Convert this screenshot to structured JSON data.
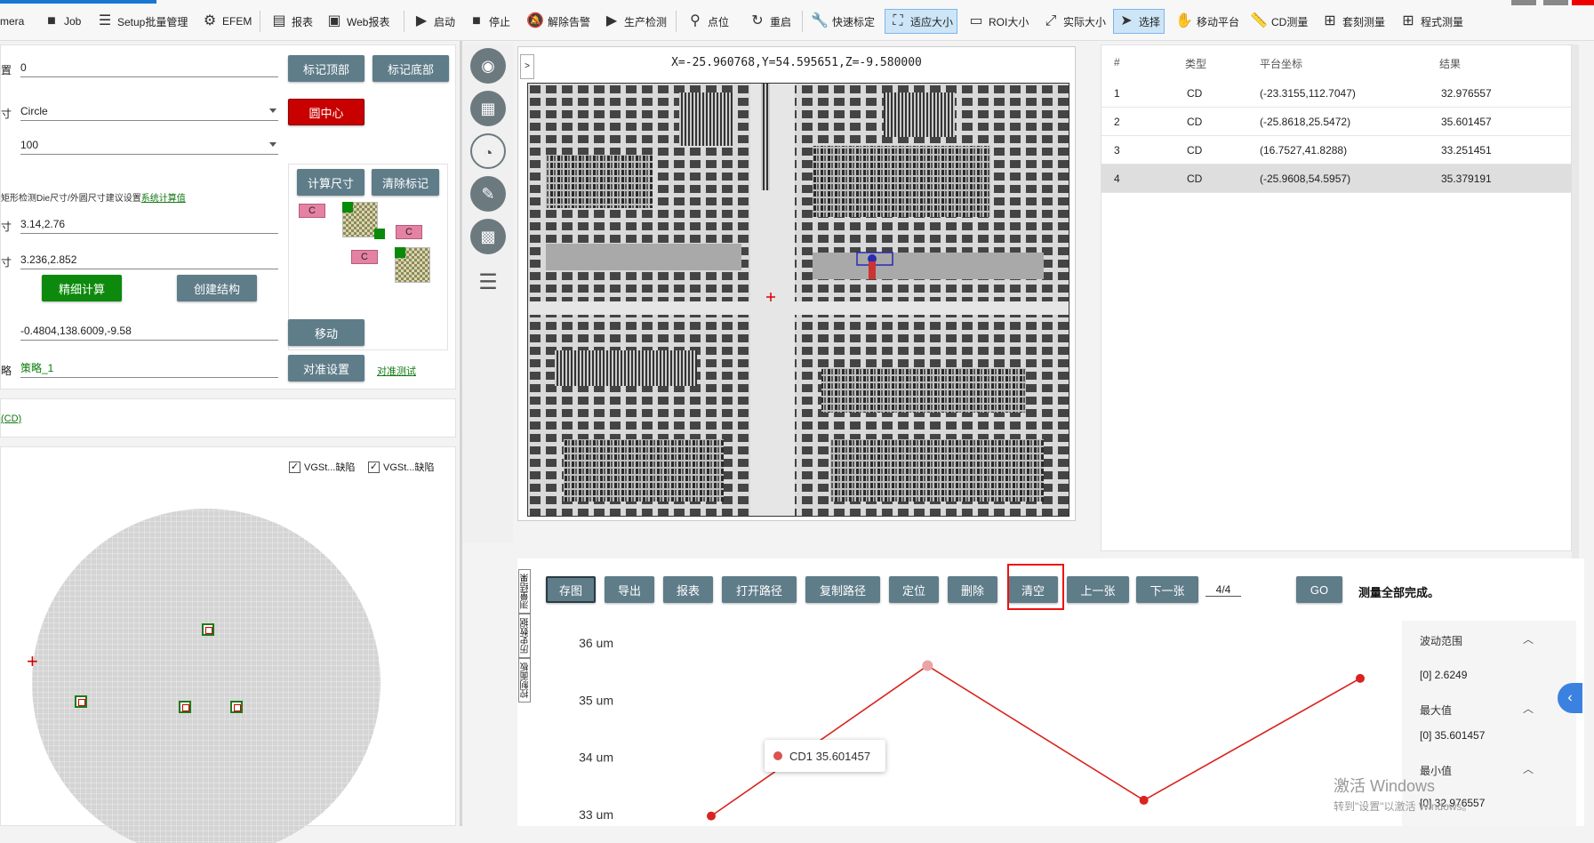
{
  "toolbar": {
    "items": [
      {
        "label": "mera",
        "icon": "camera-icon"
      },
      {
        "label": "Job",
        "icon": "briefcase-icon"
      },
      {
        "label": "Setup批量管理",
        "icon": "checklist-icon"
      },
      {
        "label": "EFEM",
        "icon": "robot-arm-icon"
      },
      {
        "label": "报表",
        "icon": "document-icon"
      },
      {
        "label": "Web报表",
        "icon": "monitor-icon"
      },
      {
        "label": "启动",
        "icon": "play-icon"
      },
      {
        "label": "停止",
        "icon": "stop-icon"
      },
      {
        "label": "解除告警",
        "icon": "bell-off-icon"
      },
      {
        "label": "生产检测",
        "icon": "play-icon"
      },
      {
        "label": "点位",
        "icon": "location-pin-icon"
      },
      {
        "label": "重启",
        "icon": "refresh-icon"
      },
      {
        "label": "快速标定",
        "icon": "wrench-icon"
      },
      {
        "label": "适应大小",
        "icon": "fit-screen-icon"
      },
      {
        "label": "ROI大小",
        "icon": "rectangle-icon"
      },
      {
        "label": "实际大小",
        "icon": "expand-icon"
      },
      {
        "label": "选择",
        "icon": "cursor-icon"
      },
      {
        "label": "移动平台",
        "icon": "hand-icon"
      },
      {
        "label": "CD测量",
        "icon": "ruler-icon"
      },
      {
        "label": "套刻测量",
        "icon": "plus-box-icon"
      },
      {
        "label": "程式测量",
        "icon": "plus-box-icon"
      }
    ]
  },
  "left_form": {
    "row1_label": "置",
    "row1_value": "0",
    "mark_top": "标记顶部",
    "mark_bottom": "标记底部",
    "row2_label": "寸",
    "row2_value": "Circle",
    "circle_center": "圆中心",
    "row3_value": "100",
    "calc_size": "计算尺寸",
    "clear_marks": "清除标记",
    "hint_text": "矩形检测Die尺寸/外圆尺寸建议设置",
    "hint_link": "系统计算值",
    "row4_label": "寸",
    "row4_value": "3.14,2.76",
    "row5_label": "寸",
    "row5_value": "3.236,2.852",
    "fine_calc": "精细计算",
    "create_struct": "创建结构",
    "row6_value": "-0.4804,138.6009,-9.58",
    "move": "移动",
    "row7_label": "略",
    "row7_value": "策略_1",
    "align_setup": "对准设置",
    "align_test": "对准测试",
    "chip_label": "C",
    "section_link": "(CD)"
  },
  "wafer_panel": {
    "cb1": "VGSt...缺陷",
    "cb2": "VGSt...缺陷"
  },
  "image_view": {
    "coord": "X=-25.960768,Y=54.595651,Z=-9.580000",
    "expander": ">"
  },
  "results": {
    "headers": [
      "#",
      "类型",
      "平台坐标",
      "结果"
    ],
    "rows": [
      {
        "idx": "1",
        "type": "CD",
        "coord": "(-23.3155,112.7047)",
        "result": "32.976557"
      },
      {
        "idx": "2",
        "type": "CD",
        "coord": "(-25.8618,25.5472)",
        "result": "35.601457"
      },
      {
        "idx": "3",
        "type": "CD",
        "coord": "(16.7527,41.8288)",
        "result": "33.251451"
      },
      {
        "idx": "4",
        "type": "CD",
        "coord": "(-25.9608,54.5957)",
        "result": "35.379191"
      }
    ]
  },
  "actions": {
    "save_image": "存图",
    "export": "导出",
    "report": "报表",
    "open_path": "打开路径",
    "copy_path": "复制路径",
    "locate": "定位",
    "delete": "删除",
    "clear": "清空",
    "prev": "上一张",
    "next": "下一张",
    "page": "4/4",
    "go": "GO",
    "status": "测量全部完成。"
  },
  "vtabs": [
    "测量结果",
    "历史数据",
    "控制面板"
  ],
  "chart_data": {
    "type": "line",
    "x": [
      1,
      2,
      3,
      4
    ],
    "series": [
      {
        "name": "CD1",
        "values": [
          32.976557,
          35.601457,
          33.251451,
          35.379191
        ],
        "color": "#d9231f"
      }
    ],
    "yticks": [
      "33 um",
      "34 um",
      "35 um",
      "36 um"
    ],
    "ylim": [
      32.8,
      36.2
    ],
    "grid": false,
    "tooltip": "CD1 35.601457"
  },
  "stats": {
    "range_title": "波动范围",
    "range_value": "[0]   2.6249",
    "max_title": "最大值",
    "max_value": "[0]   35.601457",
    "min_title": "最小值",
    "min_value": "[0]   32.976557"
  },
  "os_watermark": {
    "line1": "激活 Windows",
    "line2": "转到\"设置\"以激活 Windows。"
  }
}
